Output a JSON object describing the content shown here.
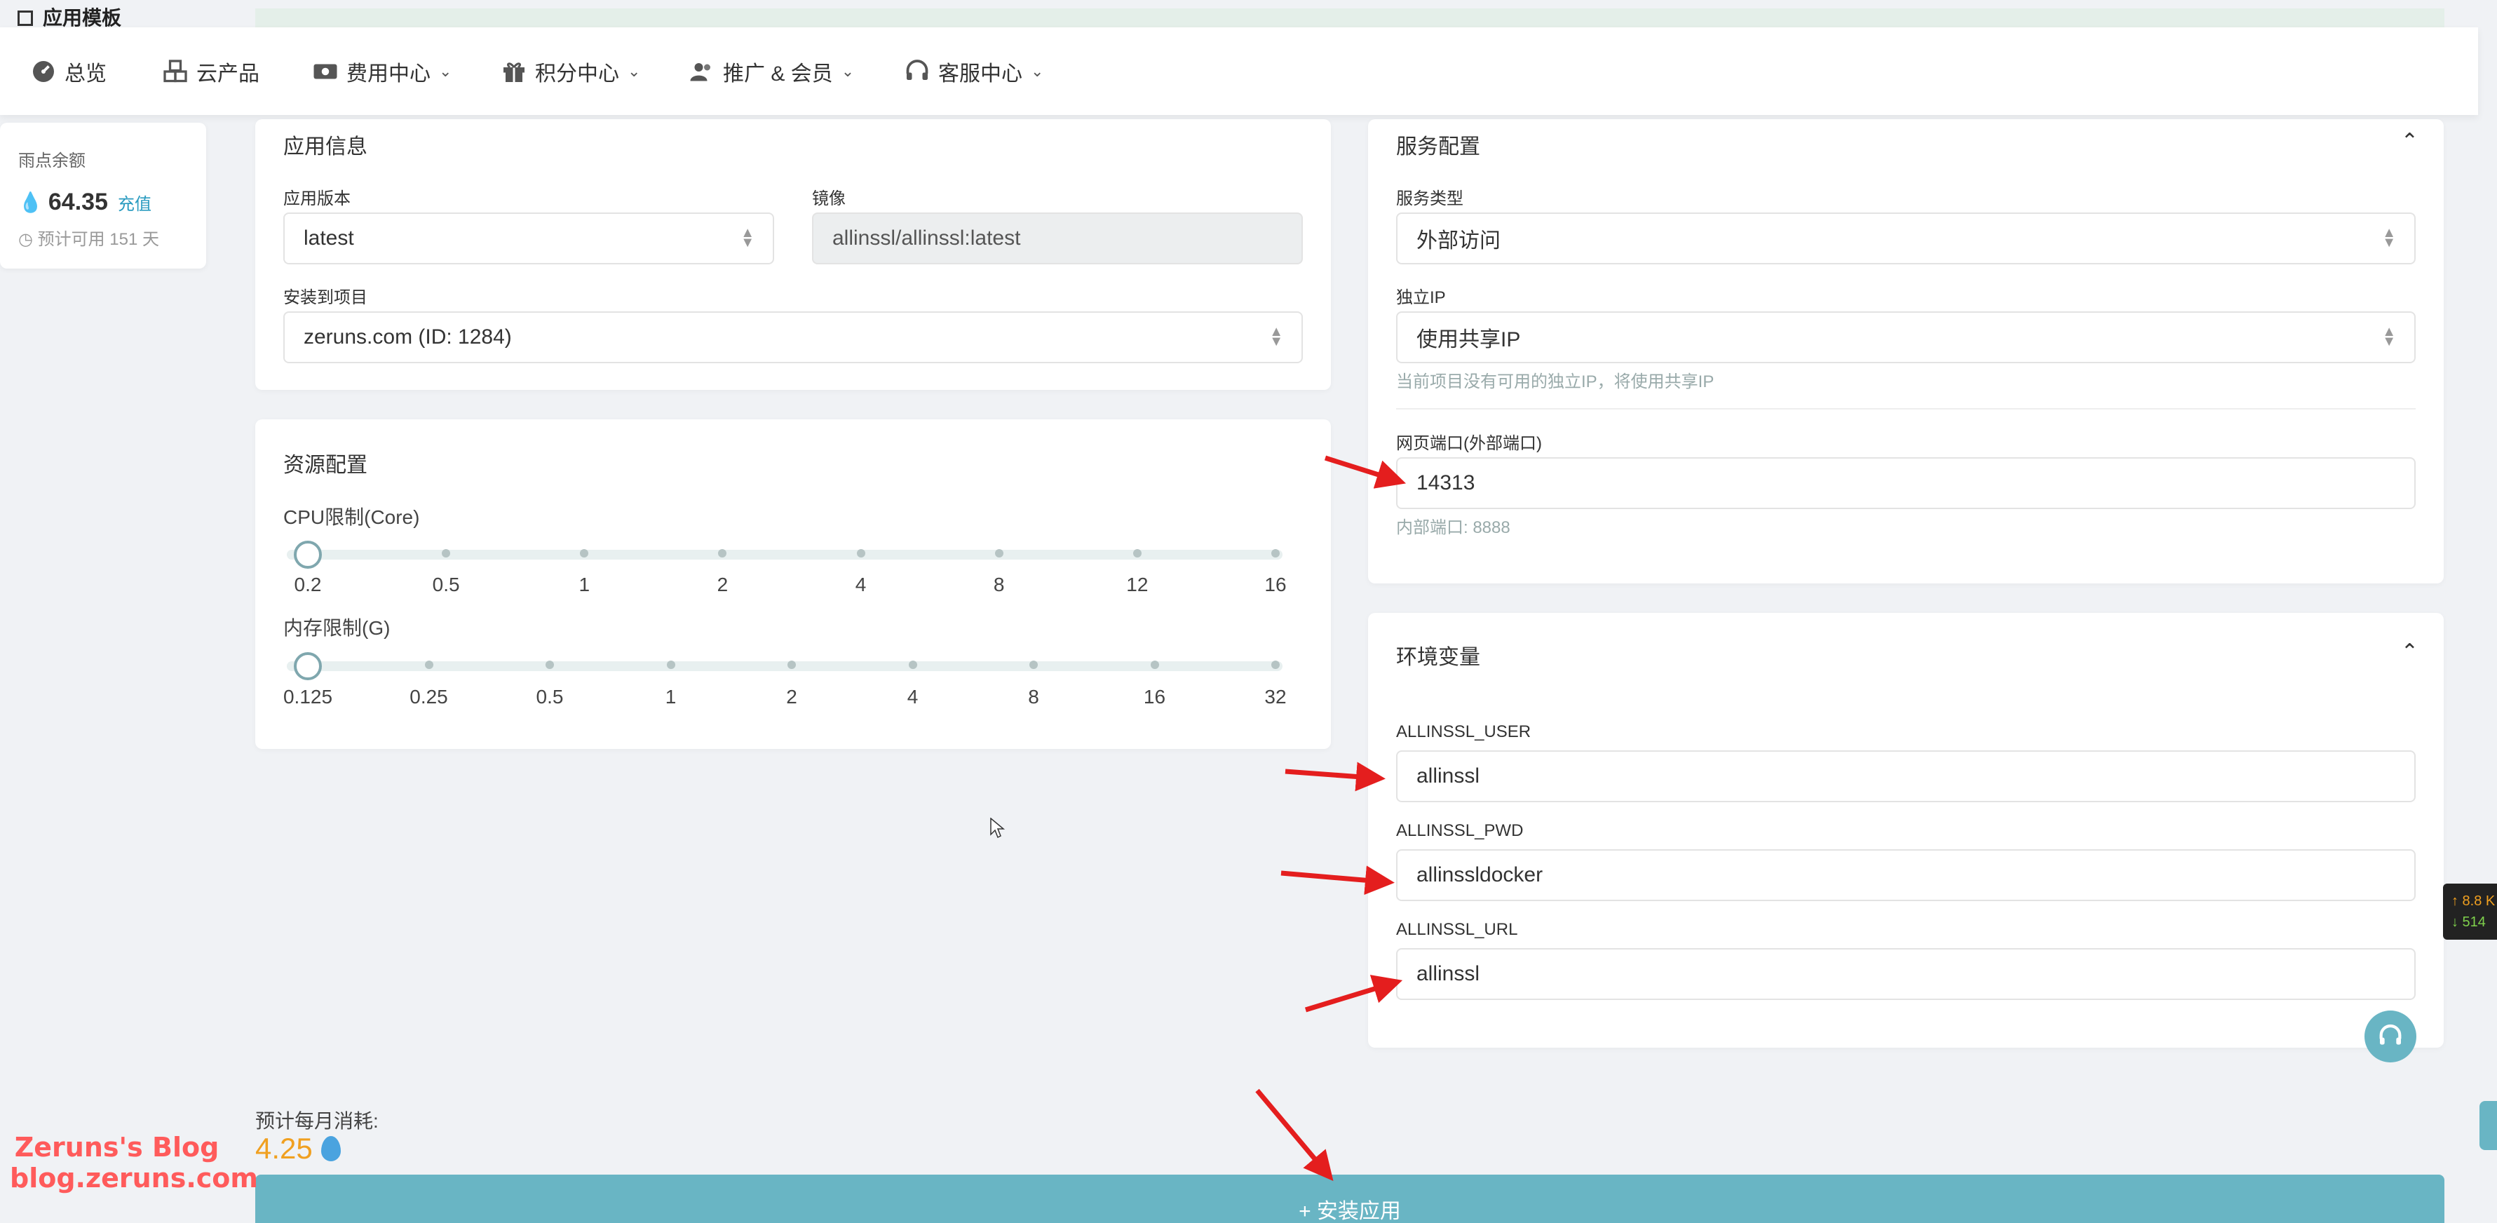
{
  "sidebar": {
    "header_label": "应用模板",
    "balance_title": "雨点余额",
    "balance_value": "64.35",
    "recharge_label": "充值",
    "estimate_label": "预计可用 151 天"
  },
  "nav": {
    "items": [
      {
        "label": "总览",
        "icon": "dashboard-icon"
      },
      {
        "label": "云产品",
        "icon": "cubes-icon"
      },
      {
        "label": "费用中心",
        "icon": "money-icon"
      },
      {
        "label": "积分中心",
        "icon": "gift-icon"
      },
      {
        "label": "推广 & 会员",
        "icon": "users-icon"
      },
      {
        "label": "客服中心",
        "icon": "headset-icon"
      }
    ]
  },
  "app_info": {
    "title": "应用信息",
    "version_label": "应用版本",
    "version_value": "latest",
    "image_label": "镜像",
    "image_value": "allinssl/allinssl:latest",
    "project_label": "安装到项目",
    "project_value": "zeruns.com (ID: 1284)"
  },
  "resources": {
    "title": "资源配置",
    "cpu_label": "CPU限制(Core)",
    "cpu_ticks": [
      "0.2",
      "0.5",
      "1",
      "2",
      "4",
      "8",
      "12",
      "16"
    ],
    "cpu_selected_index": 0,
    "mem_label": "内存限制(G)",
    "mem_ticks": [
      "0.125",
      "0.25",
      "0.5",
      "1",
      "2",
      "4",
      "8",
      "16",
      "32"
    ],
    "mem_selected_index": 0
  },
  "service": {
    "title": "服务配置",
    "type_label": "服务类型",
    "type_value": "外部访问",
    "ip_label": "独立IP",
    "ip_value": "使用共享IP",
    "ip_hint": "当前项目没有可用的独立IP，将使用共享IP",
    "port_label": "网页端口(外部端口)",
    "port_value": "14313",
    "internal_port": "内部端口: 8888"
  },
  "env": {
    "title": "环境变量",
    "vars": [
      {
        "name": "ALLINSSL_USER",
        "value": "allinssl"
      },
      {
        "name": "ALLINSSL_PWD",
        "value": "allinssldocker"
      },
      {
        "name": "ALLINSSL_URL",
        "value": "allinssl"
      }
    ]
  },
  "footer": {
    "monthly_label": "预计每月消耗:",
    "monthly_value": "4.25",
    "install_label": "+ 安装应用"
  },
  "watermark": {
    "line1": "Zeruns's Blog",
    "line2": "blog.zeruns.com"
  },
  "net_widget": {
    "up": "↑ 8.8 K",
    "down": "↓ 514"
  },
  "colors": {
    "accent": "#69b5c4",
    "link": "#2a9bc0",
    "monthly": "#f0a020",
    "arrow": "#e41e1e",
    "watermark": "#ff5b5b"
  }
}
